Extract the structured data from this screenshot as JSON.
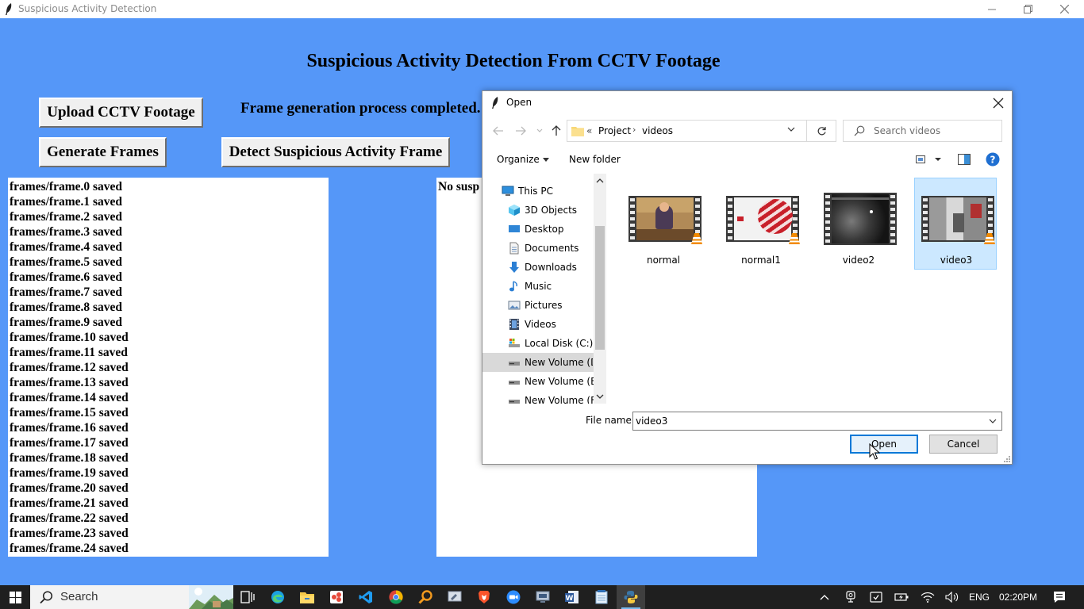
{
  "window": {
    "title": "Suspicious Activity Detection"
  },
  "app": {
    "heading": "Suspicious Activity Detection From CCTV Footage",
    "upload_button": "Upload CCTV Footage",
    "generate_button": "Generate Frames",
    "detect_button": "Detect Suspicious Activity Frame",
    "status": "Frame generation process completed.",
    "log_lines": [
      "frames/frame.0 saved",
      "frames/frame.1 saved",
      "frames/frame.2 saved",
      "frames/frame.3 saved",
      "frames/frame.4 saved",
      "frames/frame.5 saved",
      "frames/frame.6 saved",
      "frames/frame.7 saved",
      "frames/frame.8 saved",
      "frames/frame.9 saved",
      "frames/frame.10 saved",
      "frames/frame.11 saved",
      "frames/frame.12 saved",
      "frames/frame.13 saved",
      "frames/frame.14 saved",
      "frames/frame.15 saved",
      "frames/frame.16 saved",
      "frames/frame.17 saved",
      "frames/frame.18 saved",
      "frames/frame.19 saved",
      "frames/frame.20 saved",
      "frames/frame.21 saved",
      "frames/frame.22 saved",
      "frames/frame.23 saved",
      "frames/frame.24 saved"
    ],
    "result_text": "No susp"
  },
  "dialog": {
    "title": "Open",
    "breadcrumb": {
      "overflow": "«",
      "parts": [
        "Project",
        "videos"
      ]
    },
    "search_placeholder": "Search videos",
    "organize": "Organize",
    "new_folder": "New folder",
    "nav_items": [
      {
        "label": "This PC",
        "icon": "this-pc-icon"
      },
      {
        "label": "3D Objects",
        "icon": "3d-objects-icon"
      },
      {
        "label": "Desktop",
        "icon": "desktop-icon"
      },
      {
        "label": "Documents",
        "icon": "documents-icon"
      },
      {
        "label": "Downloads",
        "icon": "downloads-icon"
      },
      {
        "label": "Music",
        "icon": "music-icon"
      },
      {
        "label": "Pictures",
        "icon": "pictures-icon"
      },
      {
        "label": "Videos",
        "icon": "videos-icon"
      },
      {
        "label": "Local Disk (C:)",
        "icon": "local-disk-icon"
      },
      {
        "label": "New Volume (D:",
        "icon": "drive-icon",
        "selected": true
      },
      {
        "label": "New Volume (E:)",
        "icon": "drive-icon"
      },
      {
        "label": "New Volume (F:)",
        "icon": "drive-icon"
      }
    ],
    "files": [
      {
        "name": "normal"
      },
      {
        "name": "normal1"
      },
      {
        "name": "video2"
      },
      {
        "name": "video3",
        "selected": true
      }
    ],
    "file_name_label": "File name:",
    "file_name_value": "video3",
    "open_button": "Open",
    "cancel_button": "Cancel"
  },
  "taskbar": {
    "search_text": "Search",
    "language": "ENG",
    "time": "02:20PM"
  },
  "colors": {
    "app_background": "#5597f8",
    "selection": "#cce8ff",
    "accent": "#0078d7",
    "taskbar": "#1f1f1f"
  }
}
